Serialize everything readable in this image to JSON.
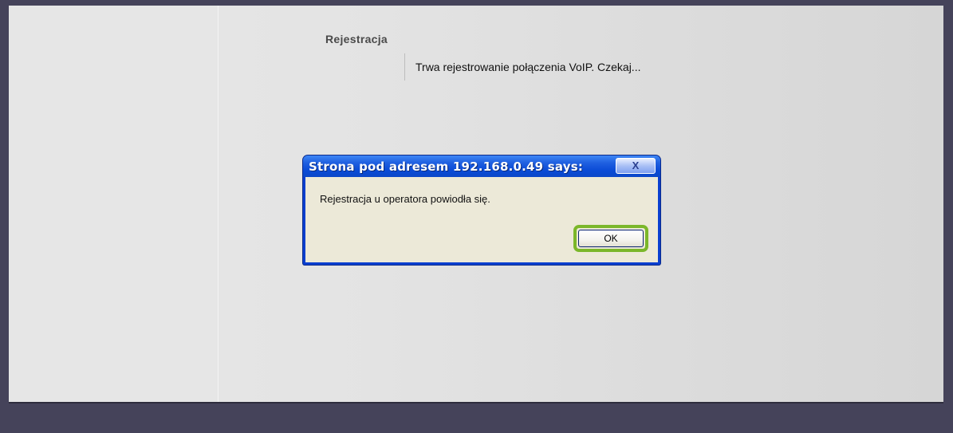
{
  "page": {
    "section_title": "Rejestracja",
    "status_text": "Trwa rejestrowanie połączenia VoIP. Czekaj..."
  },
  "dialog": {
    "title": "Strona pod adresem 192.168.0.49 says:",
    "message": "Rejestracja u operatora powiodła się.",
    "ok_label": "OK",
    "close_icon": "close-icon",
    "close_glyph": "X",
    "highlight_color": "#7bb72a"
  },
  "colors": {
    "titlebar_blue": "#0a4bd6",
    "dialog_body": "#ece9d8",
    "outer_background": "#45435a"
  }
}
